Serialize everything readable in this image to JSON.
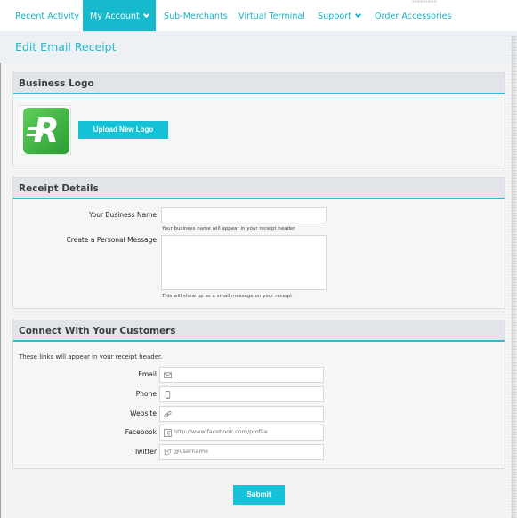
{
  "nav": {
    "items": [
      {
        "label": "Recent Activity"
      },
      {
        "label": "My Account",
        "active": true
      },
      {
        "label": "Sub-Merchants"
      },
      {
        "label": "Virtual Terminal"
      },
      {
        "label": "Support"
      },
      {
        "label": "Order Accessories"
      }
    ]
  },
  "page": {
    "title": "Edit Email Receipt"
  },
  "business_logo": {
    "heading": "Business Logo",
    "logo_icon": "green-r-logo",
    "logo_letter": "R",
    "upload_label": "Upload New Logo"
  },
  "receipt_details": {
    "heading": "Receipt Details",
    "business_name_label": "Your Business Name",
    "business_name_value": "",
    "business_name_hint": "Your business name will appear in your receipt header",
    "message_label": "Create a Personal Message",
    "message_value": "",
    "message_hint": "This will show up as a small message on your receipt"
  },
  "connect": {
    "heading": "Connect With Your Customers",
    "intro": "These links will appear in your receipt header.",
    "fields": {
      "email": {
        "label": "Email",
        "placeholder": "",
        "icon": "envelope-icon"
      },
      "phone": {
        "label": "Phone",
        "placeholder": "",
        "icon": "phone-icon"
      },
      "website": {
        "label": "Website",
        "placeholder": "",
        "icon": "link-icon"
      },
      "facebook": {
        "label": "Facebook",
        "placeholder": "http://www.facebook.com/profile",
        "icon": "facebook-icon"
      },
      "twitter": {
        "label": "Twitter",
        "placeholder": "@username",
        "icon": "twitter-icon"
      }
    }
  },
  "submit_label": "Submit",
  "colors": {
    "accent": "#17b9cc",
    "panel_head": "#e1e4e8",
    "logo_green": "#3db84a"
  }
}
